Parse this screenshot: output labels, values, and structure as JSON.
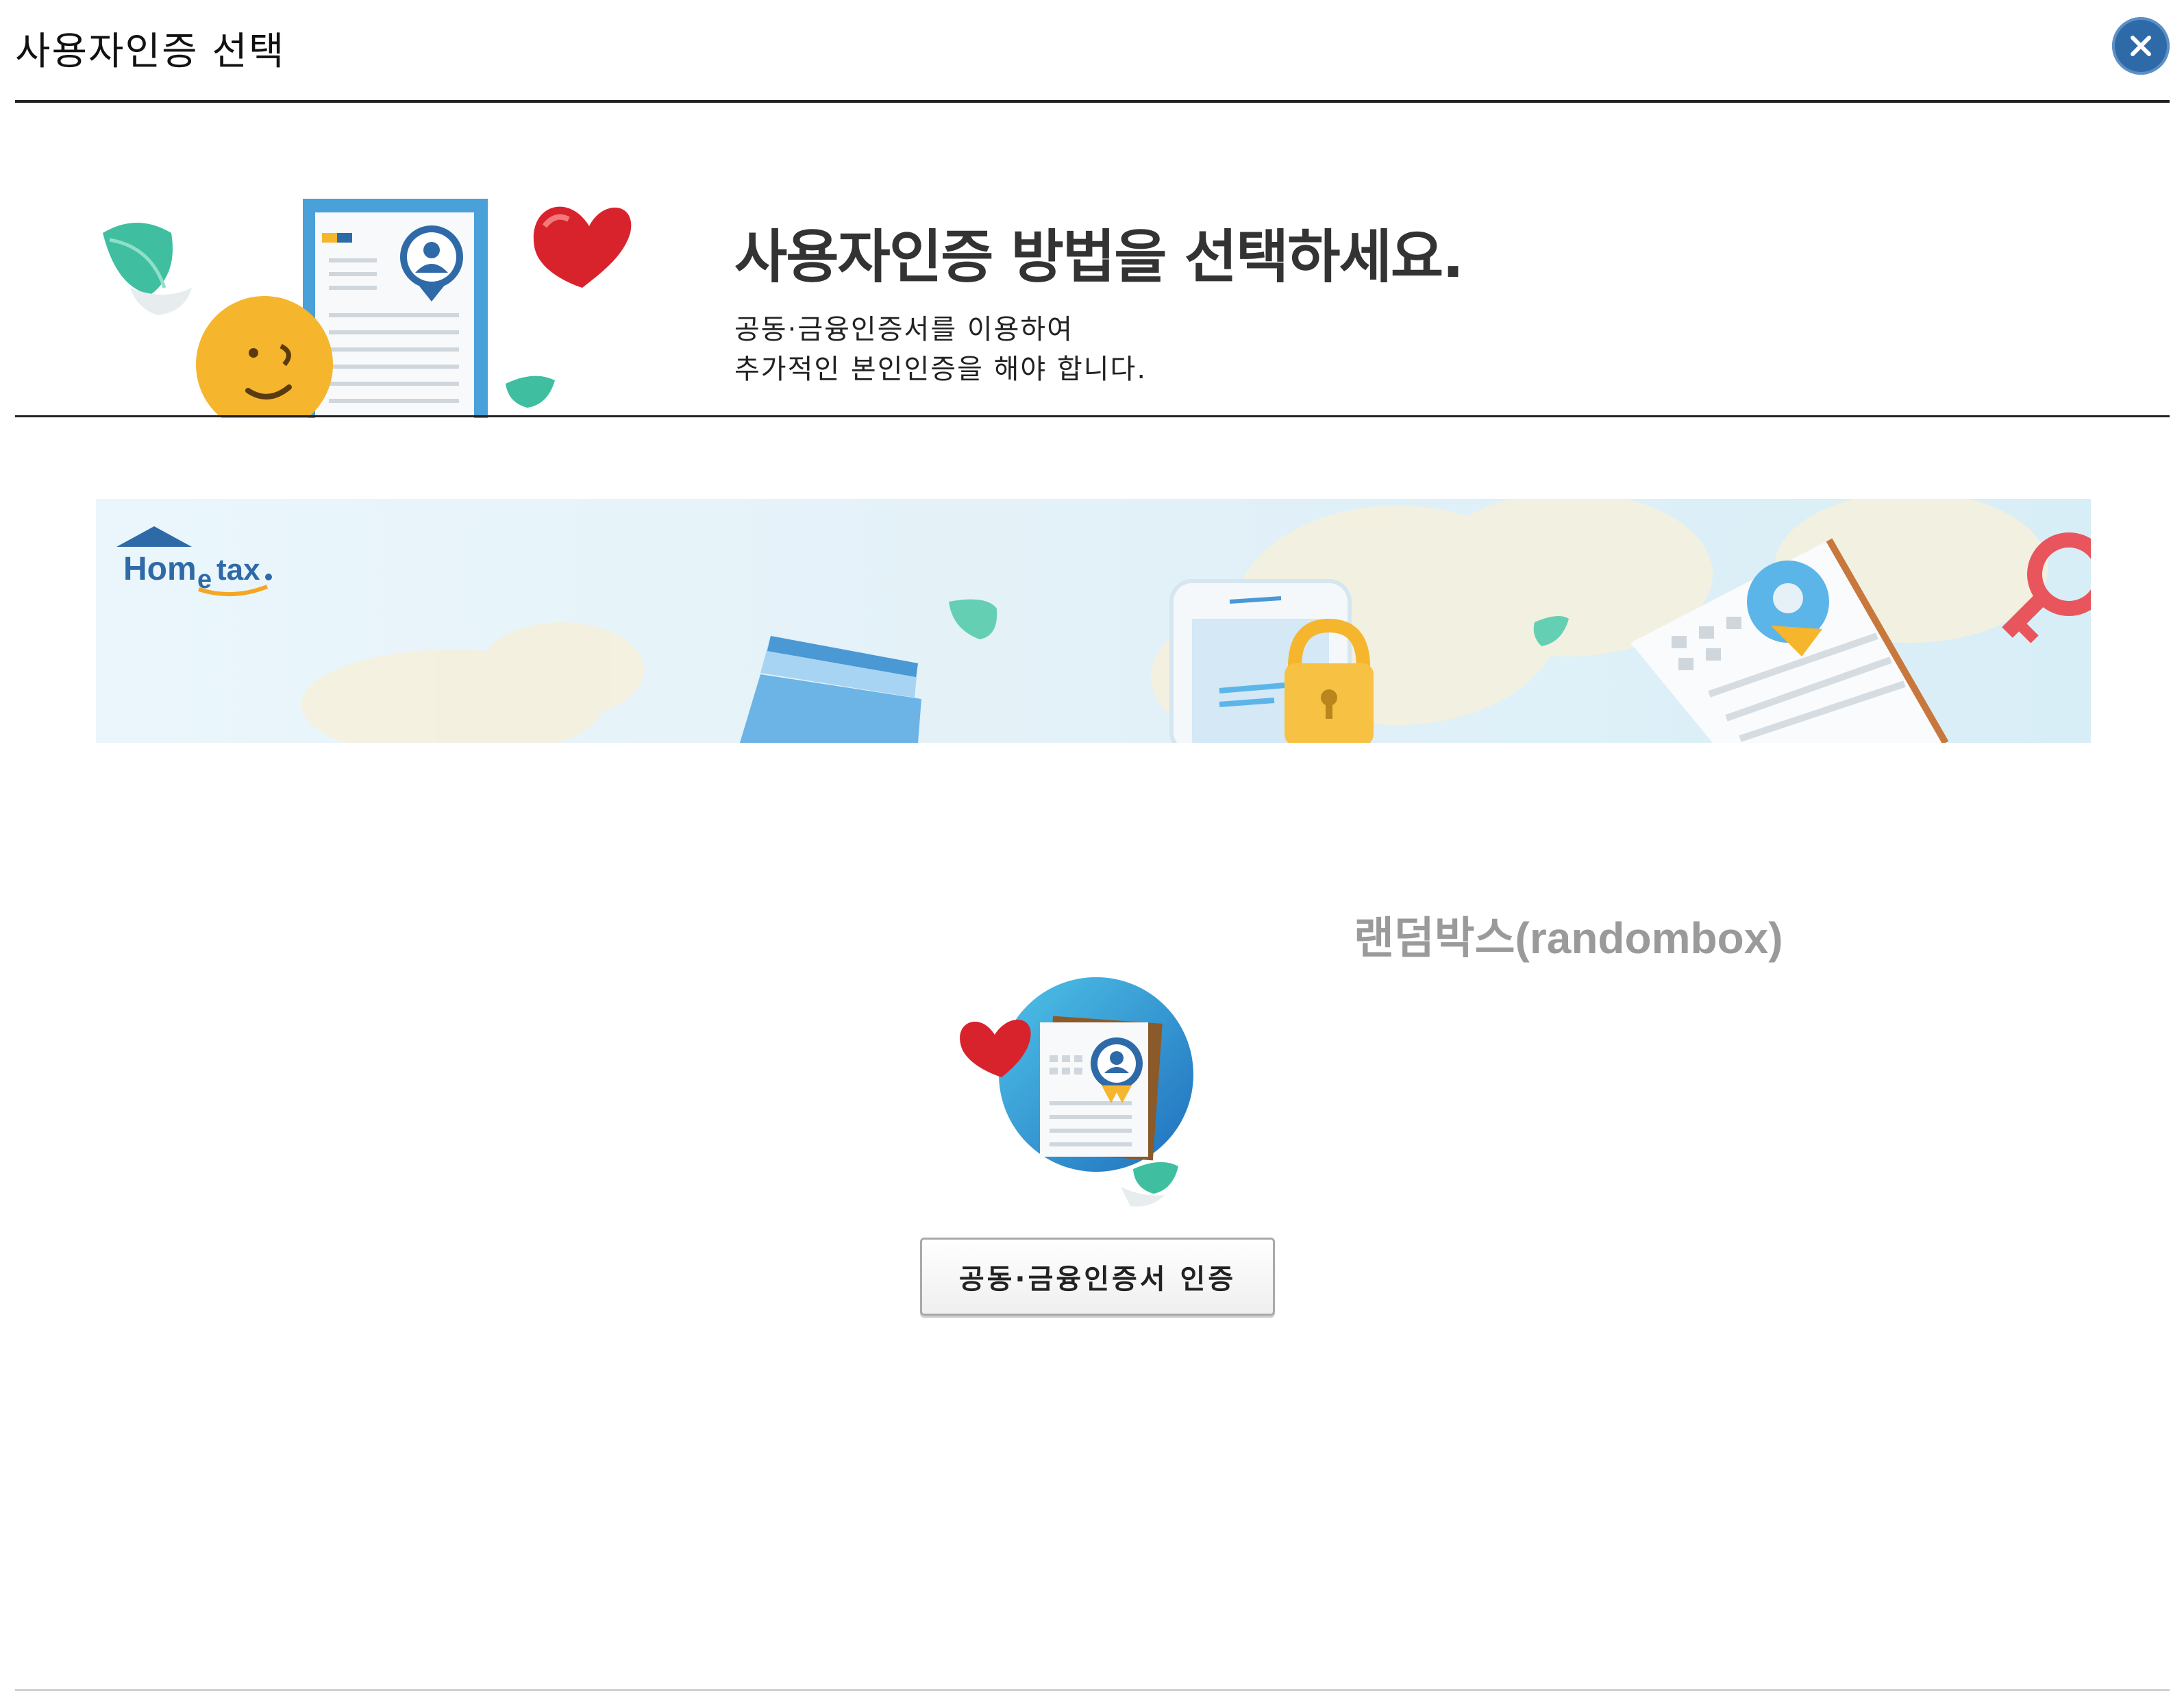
{
  "header": {
    "title": "사용자인증 선택",
    "close_label": "×"
  },
  "intro": {
    "heading": "사용자인증 방법을 선택하세요.",
    "line1": "공동·금융인증서를 이용하여",
    "line2": "추가적인 본인인증을 해야 합니다."
  },
  "banner": {
    "logo_text": "Hometax"
  },
  "overlay": {
    "randombox": "랜덤박스(randombox)"
  },
  "auth": {
    "cert_button_label": "공동·금융인증서 인증"
  },
  "colors": {
    "accent_blue": "#2f6aa8",
    "heart_red": "#d9232c",
    "leaf_green": "#3fbf9f",
    "face_yellow": "#f5b52d"
  }
}
